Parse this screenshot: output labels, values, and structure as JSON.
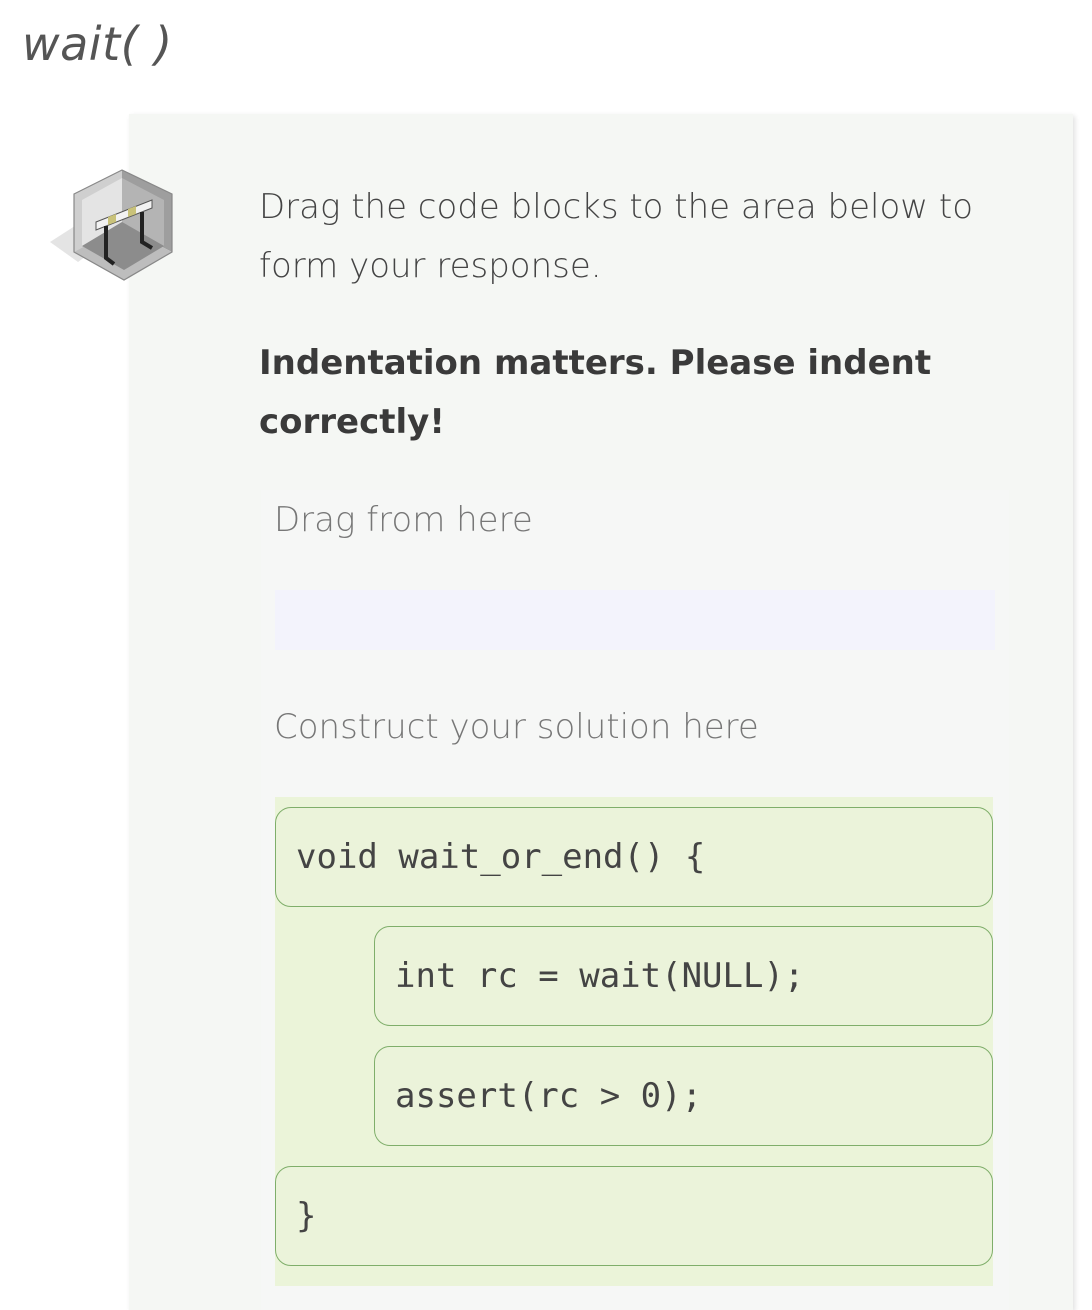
{
  "page": {
    "title": "wait( )"
  },
  "question": {
    "avatar_icon": "hurdle-icon",
    "instructions": "Drag the code blocks to the area below to form your response.",
    "emphasis": "Indentation matters. Please indent correctly!"
  },
  "parsons": {
    "source_label": "Drag from here",
    "target_label": "Construct your solution here",
    "blocks": [
      {
        "code": "void wait_or_end() {",
        "indent": 0
      },
      {
        "code": "int rc = wait(NULL);",
        "indent": 1
      },
      {
        "code": "assert(rc > 0);",
        "indent": 1
      },
      {
        "code": "}",
        "indent": 0
      }
    ]
  },
  "colors": {
    "card_background": "#f5f7f4",
    "source_area": "#f3f3fc",
    "target_area": "#ebf4d9",
    "block_border": "#7fae6a"
  }
}
